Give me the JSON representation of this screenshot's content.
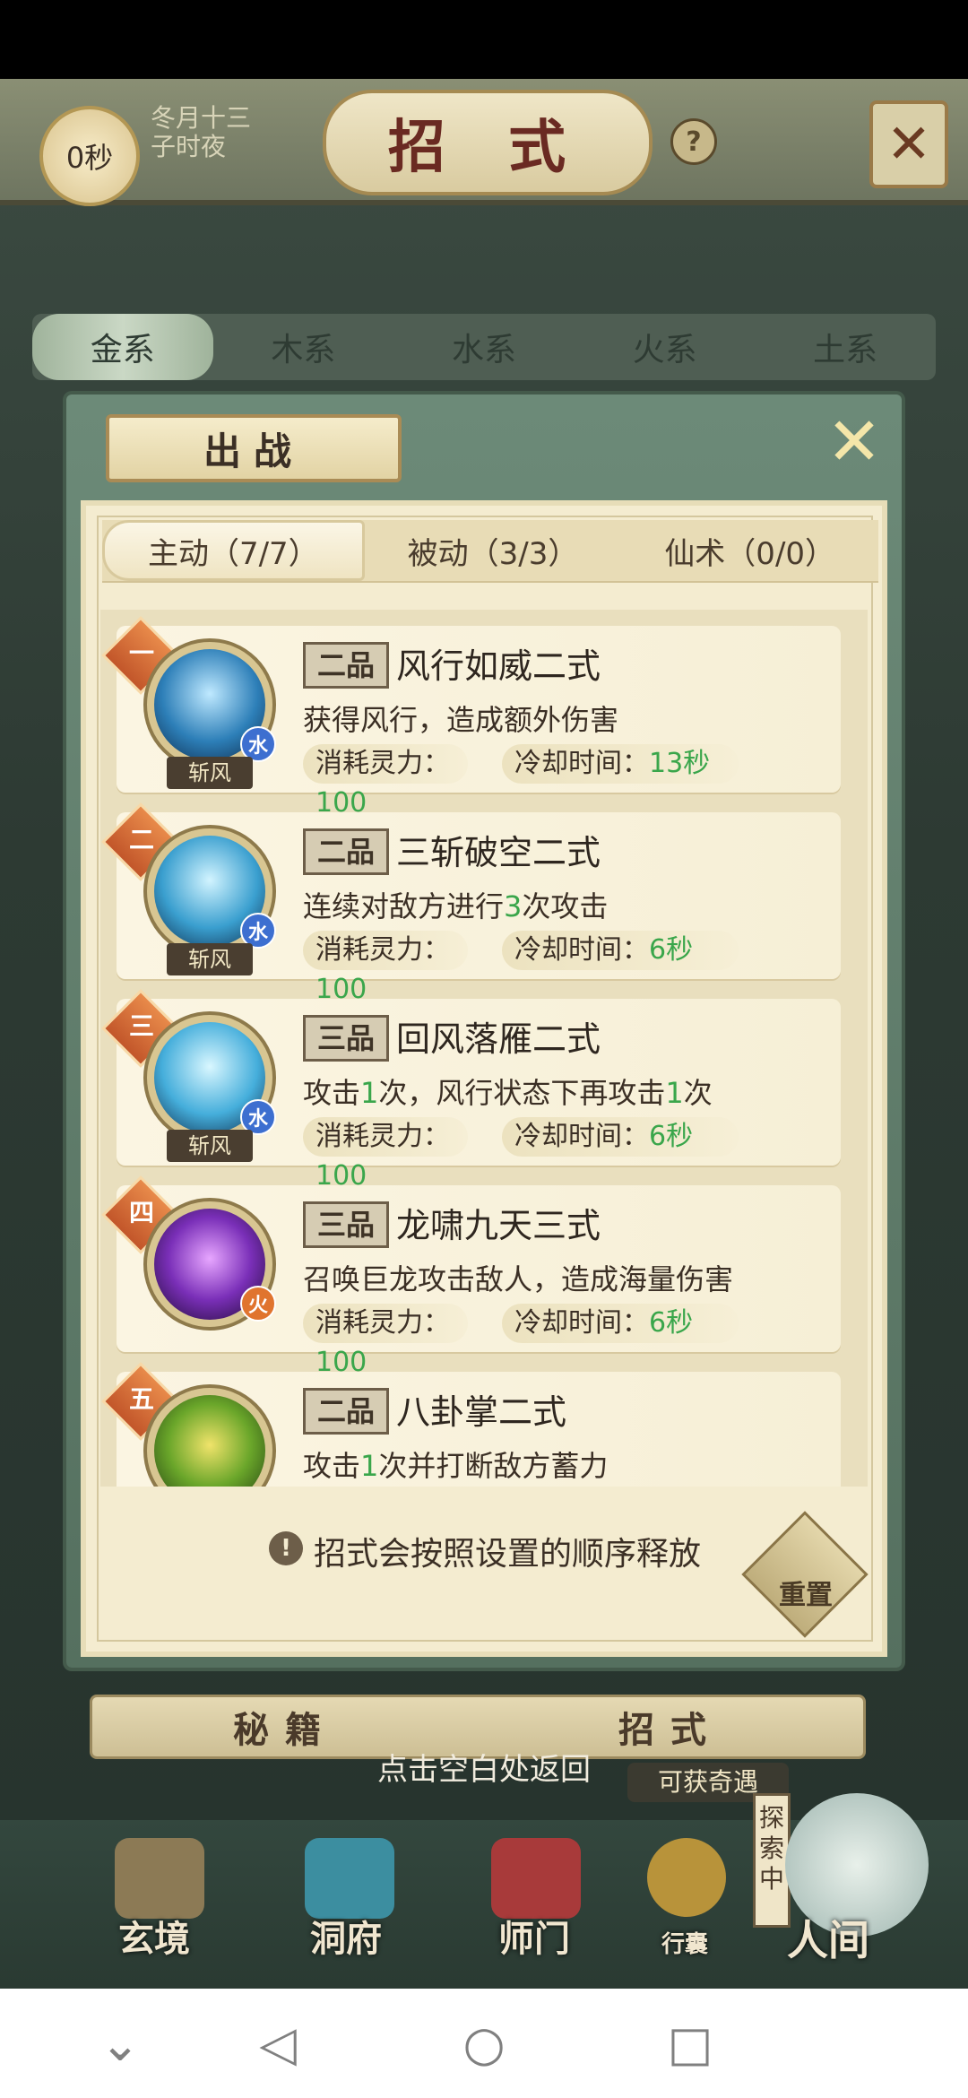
{
  "header": {
    "timer": "0秒",
    "date_line1": "冬月十三",
    "date_line2": "子时夜",
    "title": "招 式",
    "help": "?"
  },
  "element_tabs": [
    "金系",
    "木系",
    "水系",
    "火系",
    "土系"
  ],
  "modal": {
    "title": "出战",
    "tabs": [
      "主动（7/7）",
      "被动（3/3）",
      "仙术（0/0）"
    ],
    "skills": [
      {
        "order": "一",
        "grade": "二品",
        "name": "风行如威二式",
        "desc_parts": [
          "获得风行，造成额外伤害"
        ],
        "cost_label": "消耗灵力：",
        "cost": "100",
        "cd_label": "冷却时间：",
        "cd": "13秒",
        "element": "水",
        "ribbon": "斩风",
        "color": "#2d7fb8"
      },
      {
        "order": "二",
        "grade": "二品",
        "name": "三斩破空二式",
        "desc_a": "连续对敌方进行",
        "desc_n": "3",
        "desc_b": "次攻击",
        "cost_label": "消耗灵力：",
        "cost": "100",
        "cd_label": "冷却时间：",
        "cd": "6秒",
        "element": "水",
        "ribbon": "斩风",
        "color": "#2d7fb8"
      },
      {
        "order": "三",
        "grade": "三品",
        "name": "回风落雁二式",
        "desc_a": "攻击",
        "desc_n": "1",
        "desc_b": "次，风行状态下再攻击",
        "desc_n2": "1",
        "desc_c": "次",
        "cost_label": "消耗灵力：",
        "cost": "100",
        "cd_label": "冷却时间：",
        "cd": "6秒",
        "element": "水",
        "ribbon": "斩风",
        "color": "#2d7fb8"
      },
      {
        "order": "四",
        "grade": "三品",
        "name": "龙啸九天三式",
        "desc": "召唤巨龙攻击敌人，造成海量伤害",
        "cost_label": "消耗灵力：",
        "cost": "100",
        "cd_label": "冷却时间：",
        "cd": "6秒",
        "element": "火",
        "color": "#6b2fa0"
      },
      {
        "order": "五",
        "grade": "二品",
        "name": "八卦掌二式",
        "desc_a": "攻击",
        "desc_n": "1",
        "desc_b": "次并打断敌方蓄力"
      }
    ],
    "hint": "招式会按照设置的顺序释放",
    "reset": "重置"
  },
  "lower_tabs": [
    "秘籍",
    "招式"
  ],
  "back_hint": "点击空白处返回",
  "obtain": "可获奇遇",
  "explore": "探索中",
  "nav": [
    "玄境",
    "洞府",
    "师门",
    "行囊",
    "人间"
  ],
  "colors": {
    "accent_green": "#3aa64b",
    "badge_orange": "#d86a35",
    "cream": "#f4ecd0"
  }
}
